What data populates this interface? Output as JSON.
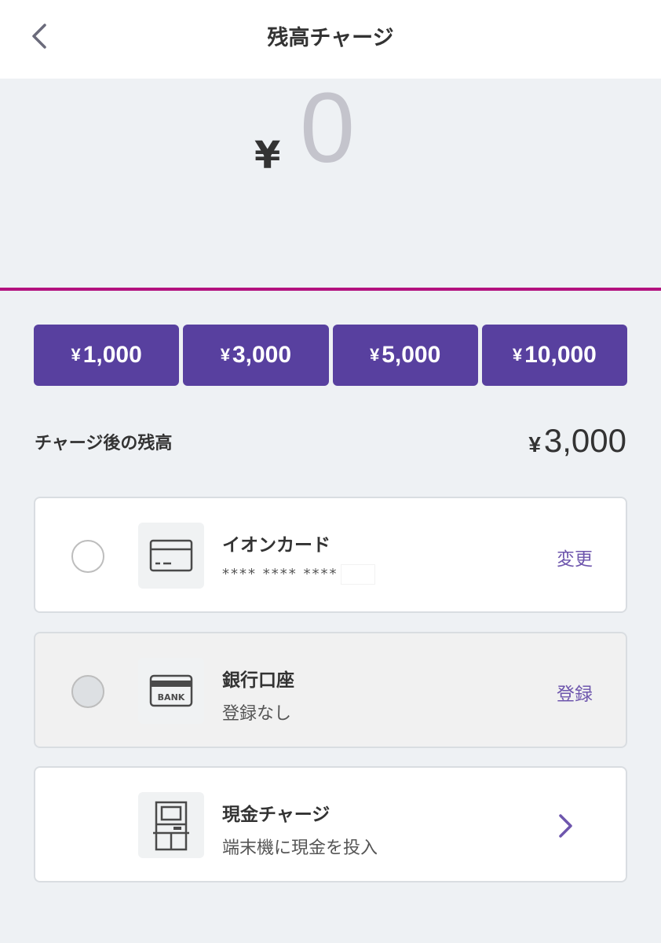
{
  "header": {
    "title": "残高チャージ"
  },
  "amount": {
    "symbol": "¥",
    "value": "0"
  },
  "presets": [
    {
      "yen": "¥",
      "amount": "1,000"
    },
    {
      "yen": "¥",
      "amount": "3,000"
    },
    {
      "yen": "¥",
      "amount": "5,000"
    },
    {
      "yen": "¥",
      "amount": "10,000"
    }
  ],
  "after": {
    "label": "チャージ後の残高",
    "yen": "¥",
    "value": "3,000"
  },
  "methods": [
    {
      "title": "イオンカード",
      "subtitle": "**** **** ****",
      "action": "変更",
      "icon": "credit-card-icon"
    },
    {
      "title": "銀行口座",
      "subtitle": "登録なし",
      "action": "登録",
      "icon": "bank-card-icon",
      "icon_text": "BANK"
    },
    {
      "title": "現金チャージ",
      "subtitle": "端末機に現金を投入",
      "icon": "atm-icon"
    }
  ],
  "colors": {
    "accent": "#58409f",
    "underline": "#b3127f",
    "link": "#6e56ad"
  }
}
